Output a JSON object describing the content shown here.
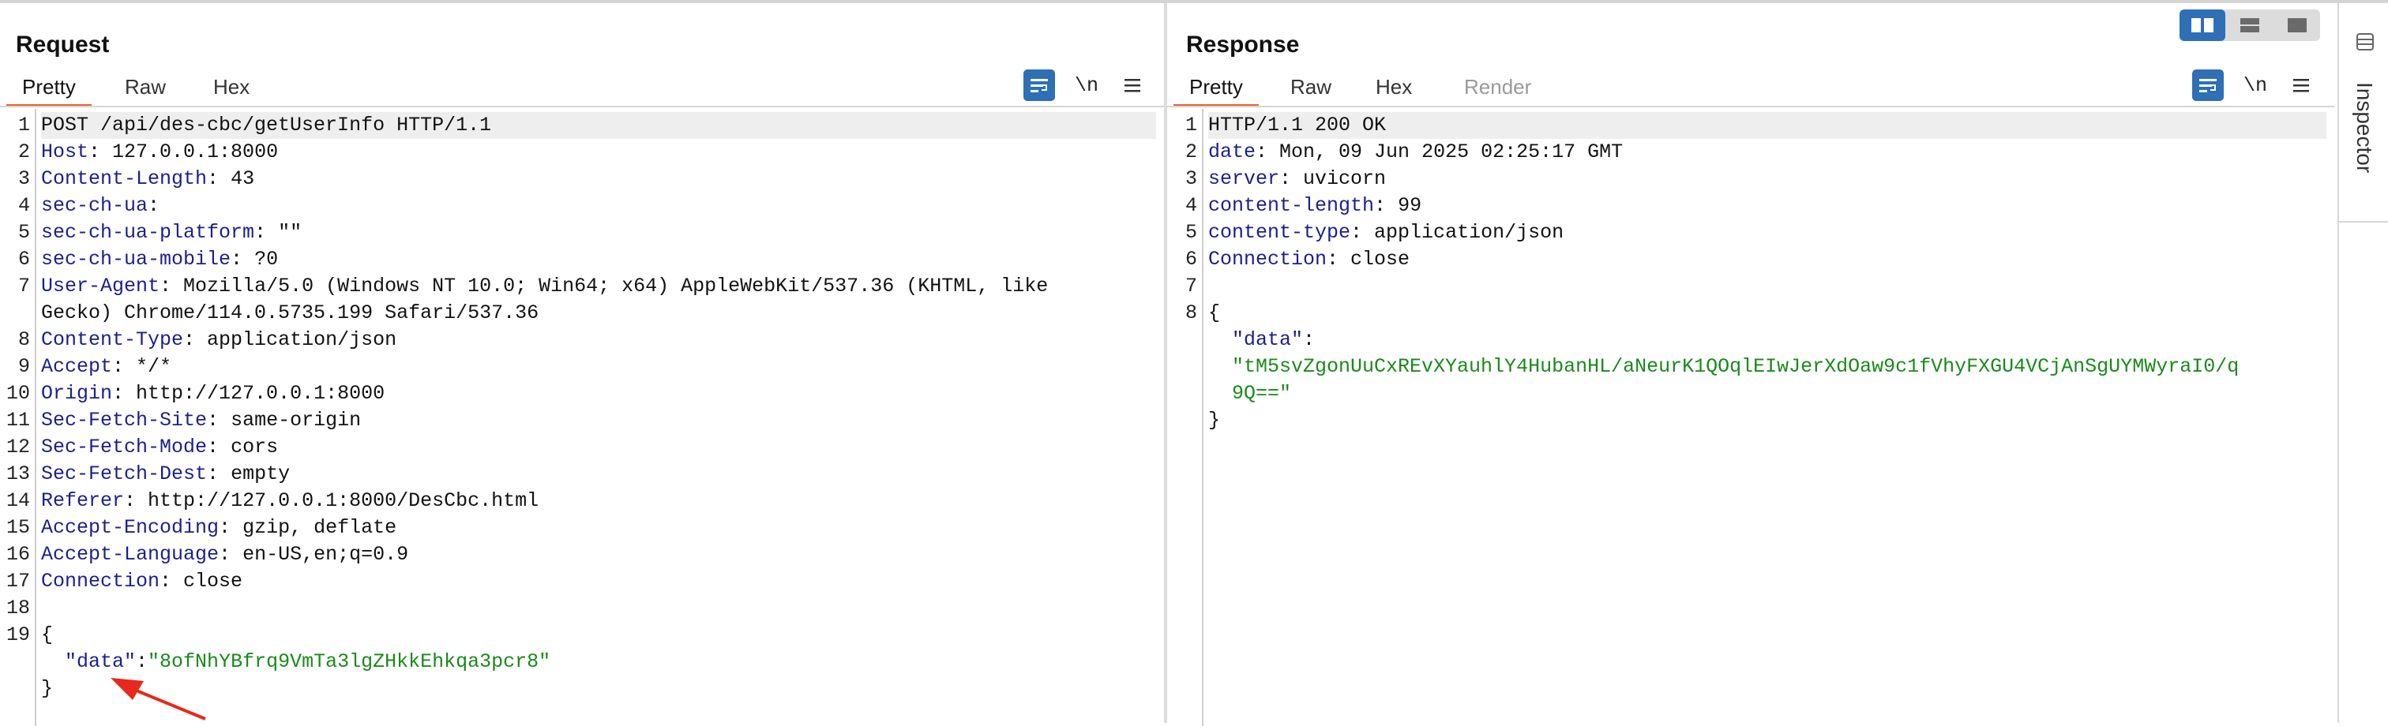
{
  "request": {
    "title": "Request",
    "tabs": [
      "Pretty",
      "Raw",
      "Hex"
    ],
    "lines": [
      {
        "num": "1",
        "text": "POST /api/des-cbc/getUserInfo HTTP/1.1"
      },
      {
        "num": "2",
        "key": "Host",
        "value": " 127.0.0.1:8000"
      },
      {
        "num": "3",
        "key": "Content-Length",
        "value": " 43"
      },
      {
        "num": "4",
        "key": "sec-ch-ua",
        "value": ""
      },
      {
        "num": "5",
        "key": "sec-ch-ua-platform",
        "value": " \"\""
      },
      {
        "num": "6",
        "key": "sec-ch-ua-mobile",
        "value": " ?0"
      },
      {
        "num": "7",
        "key": "User-Agent",
        "value": " Mozilla/5.0 (Windows NT 10.0; Win64; x64) AppleWebKit/537.36 (KHTML, like"
      },
      {
        "num": "",
        "text": "Gecko) Chrome/114.0.5735.199 Safari/537.36"
      },
      {
        "num": "8",
        "key": "Content-Type",
        "value": " application/json"
      },
      {
        "num": "9",
        "key": "Accept",
        "value": " */*"
      },
      {
        "num": "10",
        "key": "Origin",
        "value": " http://127.0.0.1:8000"
      },
      {
        "num": "11",
        "key": "Sec-Fetch-Site",
        "value": " same-origin"
      },
      {
        "num": "12",
        "key": "Sec-Fetch-Mode",
        "value": " cors"
      },
      {
        "num": "13",
        "key": "Sec-Fetch-Dest",
        "value": " empty"
      },
      {
        "num": "14",
        "key": "Referer",
        "value": " http://127.0.0.1:8000/DesCbc.html"
      },
      {
        "num": "15",
        "key": "Accept-Encoding",
        "value": " gzip, deflate"
      },
      {
        "num": "16",
        "key": "Accept-Language",
        "value": " en-US,en;q=0.9"
      },
      {
        "num": "17",
        "key": "Connection",
        "value": " close"
      },
      {
        "num": "18",
        "text": ""
      },
      {
        "num": "19",
        "text": "{"
      },
      {
        "num": "",
        "jkey": "  \"data\"",
        "jsep": ":",
        "jval": "\"8ofNhYBfrq9VmTa3lgZHkkEhkqa3pcr8\""
      },
      {
        "num": "",
        "text": "}"
      }
    ]
  },
  "response": {
    "title": "Response",
    "tabs": [
      "Pretty",
      "Raw",
      "Hex",
      "Render"
    ],
    "lines": [
      {
        "num": "1",
        "text": "HTTP/1.1 200 OK"
      },
      {
        "num": "2",
        "key": "date",
        "value": " Mon, 09 Jun 2025 02:25:17 GMT"
      },
      {
        "num": "3",
        "key": "server",
        "value": " uvicorn"
      },
      {
        "num": "4",
        "key": "content-length",
        "value": " 99"
      },
      {
        "num": "5",
        "key": "content-type",
        "value": " application/json"
      },
      {
        "num": "6",
        "key": "Connection",
        "value": " close"
      },
      {
        "num": "7",
        "text": ""
      },
      {
        "num": "8",
        "text": "{"
      },
      {
        "num": "",
        "jkey": "  \"data\"",
        "jsep": ":",
        "jval": ""
      },
      {
        "num": "",
        "jval": "  \"tM5svZgonUuCxREvXYauhlY4HubanHL/aNeurK1QOqlEIwJerXdOaw9c1fVhyFXGU4VCjAnSgUYMWyraI0/q"
      },
      {
        "num": "",
        "jval": "  9Q==\""
      },
      {
        "num": "",
        "text": "}"
      }
    ]
  },
  "toolbar": {
    "newline_label": "\\n"
  },
  "inspector": {
    "label": "Inspector"
  },
  "colors": {
    "accent": "#2e6fb5",
    "tab_underline": "#e8642c",
    "header_key": "#1b1f8c",
    "string_value": "#1a8a1a",
    "annotation_arrow": "#e8281c"
  }
}
